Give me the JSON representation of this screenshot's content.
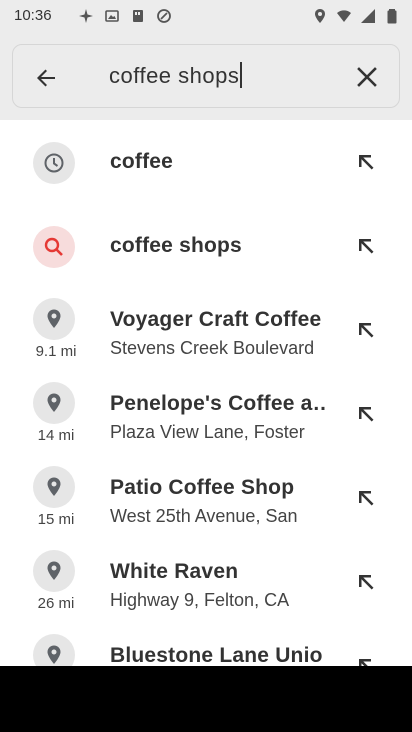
{
  "status_bar": {
    "time": "10:36"
  },
  "search": {
    "query": "coffee shops"
  },
  "suggestions": [
    {
      "type": "history",
      "title": "coffee",
      "subtitle": "",
      "distance": ""
    },
    {
      "type": "search",
      "title": "coffee shops",
      "subtitle": "",
      "distance": ""
    },
    {
      "type": "place",
      "title": "Voyager Craft Coffee",
      "subtitle": "Stevens Creek Boulevard",
      "distance": "9.1 mi"
    },
    {
      "type": "place",
      "title": "Penelope's Coffee a…",
      "subtitle": "Plaza View Lane, Foster",
      "distance": "14 mi"
    },
    {
      "type": "place",
      "title": "Patio Coffee Shop",
      "subtitle": "West 25th Avenue, San",
      "distance": "15 mi"
    },
    {
      "type": "place",
      "title": "White Raven",
      "subtitle": "Highway 9, Felton, CA",
      "distance": "26 mi"
    },
    {
      "type": "place",
      "title": "Bluestone Lane Unio",
      "subtitle": "",
      "distance": ""
    }
  ],
  "icons": {
    "back": "arrow-back-icon",
    "clear": "close-icon",
    "history": "history-clock-icon",
    "search": "search-icon",
    "place": "place-pin-icon",
    "fill": "north-west-arrow-icon"
  },
  "colors": {
    "search_accent": "#e53935",
    "icon_gray": "#5f6368"
  }
}
